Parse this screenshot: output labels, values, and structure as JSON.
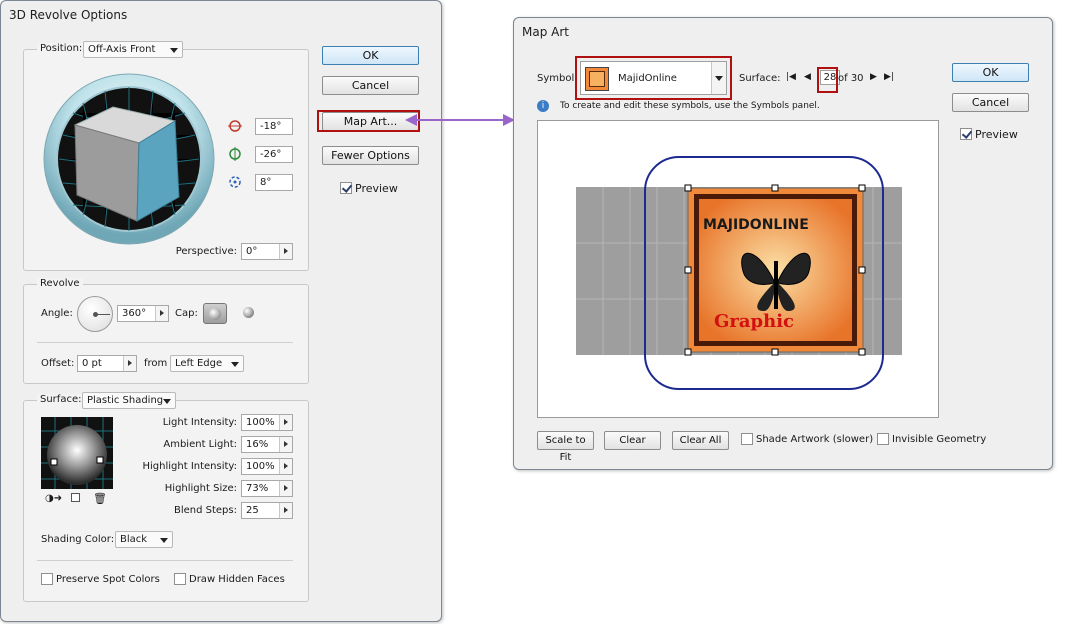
{
  "revolve_dialog": {
    "title": "3D Revolve Options",
    "position": {
      "label": "Position:",
      "value": "Off-Axis Front",
      "rot_x": "-18°",
      "rot_y": "-26°",
      "rot_z": "8°",
      "perspective_label": "Perspective:",
      "perspective_value": "0°"
    },
    "revolve": {
      "label": "Revolve",
      "angle_label": "Angle:",
      "angle_value": "360°",
      "cap_label": "Cap:",
      "offset_label": "Offset:",
      "offset_value": "0 pt",
      "from_label": "from",
      "from_value": "Left Edge"
    },
    "surface": {
      "label": "Surface:",
      "value": "Plastic Shading",
      "light_intensity_label": "Light Intensity:",
      "light_intensity": "100%",
      "ambient_light_label": "Ambient Light:",
      "ambient_light": "16%",
      "highlight_intensity_label": "Highlight Intensity:",
      "highlight_intensity": "100%",
      "highlight_size_label": "Highlight Size:",
      "highlight_size": "73%",
      "blend_steps_label": "Blend Steps:",
      "blend_steps": "25",
      "shading_color_label": "Shading Color:",
      "shading_color": "Black",
      "preserve_spot_colors": "Preserve Spot Colors",
      "draw_hidden_faces": "Draw Hidden Faces"
    },
    "buttons": {
      "ok": "OK",
      "cancel": "Cancel",
      "map_art": "Map Art...",
      "fewer_options": "Fewer Options",
      "preview": "Preview"
    }
  },
  "map_art_dialog": {
    "title": "Map Art",
    "symbol_label": "Symbol:",
    "symbol_value": "MajidOnline",
    "surface_label": "Surface:",
    "surface_current": "28",
    "surface_total": "of 30",
    "info_text": "To create and edit these symbols, use the Symbols panel.",
    "art_title": "MAJIDONLINE",
    "art_subtitle": "Graphic",
    "buttons": {
      "ok": "OK",
      "cancel": "Cancel",
      "preview": "Preview",
      "scale_to_fit": "Scale to Fit",
      "clear": "Clear",
      "clear_all": "Clear All",
      "shade_artwork": "Shade Artwork (slower)",
      "invisible_geometry": "Invisible Geometry"
    }
  },
  "colors": {
    "cube_face": "#5aa4bf",
    "highlight_red": "#b01010",
    "arrow_purple": "#9a66cc",
    "art_orange": "#f08a3a",
    "selection_blue": "#1c2a8f"
  }
}
